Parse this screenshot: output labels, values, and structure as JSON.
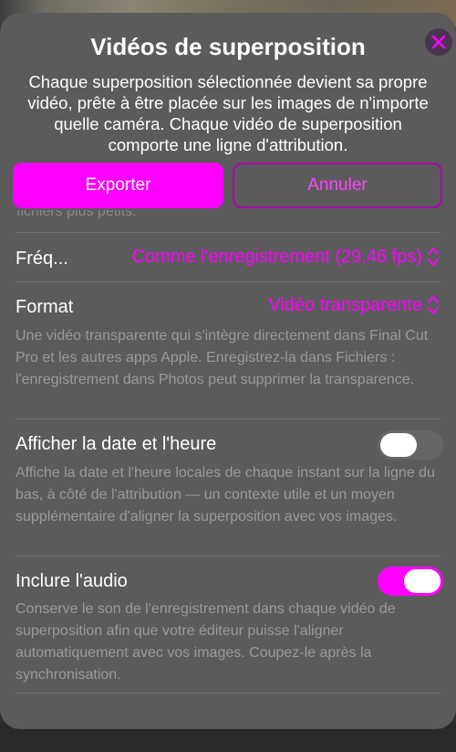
{
  "sheet": {
    "title": "Vidéos de superposition",
    "description": "Chaque superposition sélectionnée devient sa propre vidéo, prête à être placée sur les images de n'importe quelle caméra. Chaque vidéo de superposition comporte une ligne d'attribution.",
    "close_icon": "close-icon",
    "accent_color": "#ff00ff"
  },
  "actions": {
    "export_label": "Exporter",
    "cancel_label": "Annuler"
  },
  "clipped_text": "fichiers plus petits.",
  "settings": {
    "frequency": {
      "label": "Fréq...",
      "value": "Comme l'enregistrement (29,46 fps)"
    },
    "format": {
      "label": "Format",
      "value": "Vidéo transparente",
      "help": "Une vidéo transparente qui s'intègre directement dans Final Cut Pro et les autres apps Apple. Enregistrez-la dans Fichiers : l'enregistrement dans Photos peut supprimer la transparence."
    },
    "show_datetime": {
      "label": "Afficher la date et l'heure",
      "enabled": false,
      "help": "Affiche la date et l'heure locales de chaque instant sur la ligne du bas, à côté de l'attribution — un contexte utile et un moyen supplémentaire d'aligner la superposition avec vos images."
    },
    "include_audio": {
      "label": "Inclure l'audio",
      "enabled": true,
      "help": "Conserve le son de l'enregistrement dans chaque vidéo de superposition afin que votre éditeur puisse l'aligner automatiquement avec vos images. Coupez-le après la synchronisation."
    }
  }
}
